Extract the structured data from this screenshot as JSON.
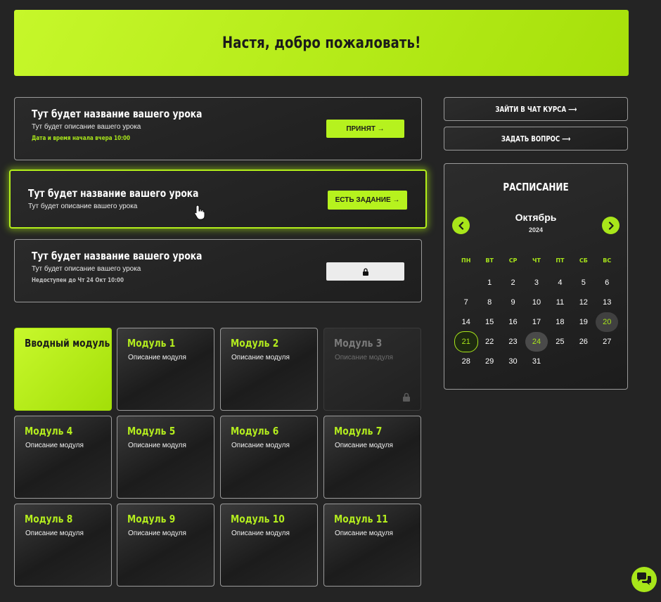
{
  "banner": {
    "title": "Настя, добро пожаловать!"
  },
  "lessons": [
    {
      "title": "Тут будет название вашего урока",
      "description": "Тут будет описание вашего урока",
      "meta": "Дата и время начала вчера 10:00",
      "button": "ПРИНЯТ →"
    },
    {
      "title": "Тут будет название вашего урока",
      "description": "Тут будет описание вашего урока",
      "button": "ЕСТЬ ЗАДАНИЕ →"
    },
    {
      "title": "Тут будет название вашего урока",
      "description": "Тут будет описание вашего урока",
      "meta": "Недоступен до Чт 24 Окт 10:00",
      "button_icon": "lock-icon"
    }
  ],
  "modules": [
    {
      "title": "Вводный модуль",
      "description": ""
    },
    {
      "title": "Модуль 1",
      "description": "Описание модуля"
    },
    {
      "title": "Модуль 2",
      "description": "Описание модуля"
    },
    {
      "title": "Модуль 3",
      "description": "Описание модуля",
      "locked": true
    },
    {
      "title": "Модуль 4",
      "description": "Описание модуля"
    },
    {
      "title": "Модуль 5",
      "description": "Описание модуля"
    },
    {
      "title": "Модуль 6",
      "description": "Описание модуля"
    },
    {
      "title": "Модуль 7",
      "description": "Описание модуля"
    },
    {
      "title": "Модуль 8",
      "description": "Описание модуля"
    },
    {
      "title": "Модуль 9",
      "description": "Описание модуля"
    },
    {
      "title": "Модуль 10",
      "description": "Описание модуля"
    },
    {
      "title": "Модуль 11",
      "description": "Описание модуля"
    }
  ],
  "sidebar": {
    "chat_button": "ЗАЙТИ В ЧАТ КУРСА ⟶",
    "ask_button": "ЗАДАТЬ ВОПРОС ⟶"
  },
  "calendar": {
    "title": "РАСПИСАНИЕ",
    "month": "Октябрь",
    "year": "2024",
    "weekdays": [
      "ПН",
      "ВТ",
      "СР",
      "ЧТ",
      "ПТ",
      "СБ",
      "ВС"
    ],
    "weeks": [
      [
        "",
        "1",
        "2",
        "3",
        "4",
        "5",
        "6"
      ],
      [
        "7",
        "8",
        "9",
        "10",
        "11",
        "12",
        "13"
      ],
      [
        "14",
        "15",
        "16",
        "17",
        "18",
        "19",
        "20"
      ],
      [
        "21",
        "22",
        "23",
        "24",
        "25",
        "26",
        "27"
      ],
      [
        "28",
        "29",
        "30",
        "31",
        "",
        "",
        ""
      ]
    ],
    "highlighted_day": "20",
    "selected_day": "21",
    "today": "24",
    "accent_color": "#a8e61a"
  },
  "fab": {
    "icon": "chat-bubbles-icon"
  }
}
